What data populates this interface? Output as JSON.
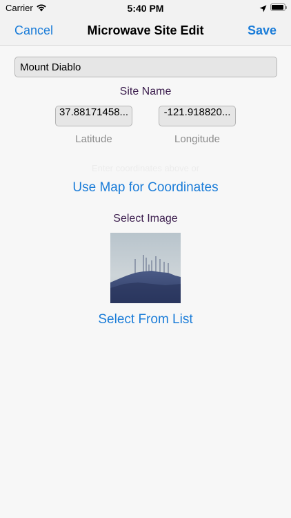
{
  "status_bar": {
    "carrier": "Carrier",
    "time": "5:40 PM",
    "battery_level": 0.95
  },
  "nav": {
    "cancel_label": "Cancel",
    "title": "Microwave Site Edit",
    "save_label": "Save"
  },
  "form": {
    "site_name_value": "Mount Diablo",
    "site_name_label": "Site Name",
    "latitude_value": "37.88171458...",
    "latitude_label": "Latitude",
    "longitude_value": "-121.918820...",
    "longitude_label": "Longitude",
    "hint": "Enter coordinates above or",
    "use_map_label": "Use Map for Coordinates",
    "select_image_label": "Select Image",
    "select_list_label": "Select From List"
  },
  "colors": {
    "accent": "#1a7cd8",
    "label": "#3c1e4e",
    "secondary": "#8a8a8a"
  },
  "icons": [
    "wifi-icon",
    "location-arrow-icon",
    "battery-icon"
  ]
}
